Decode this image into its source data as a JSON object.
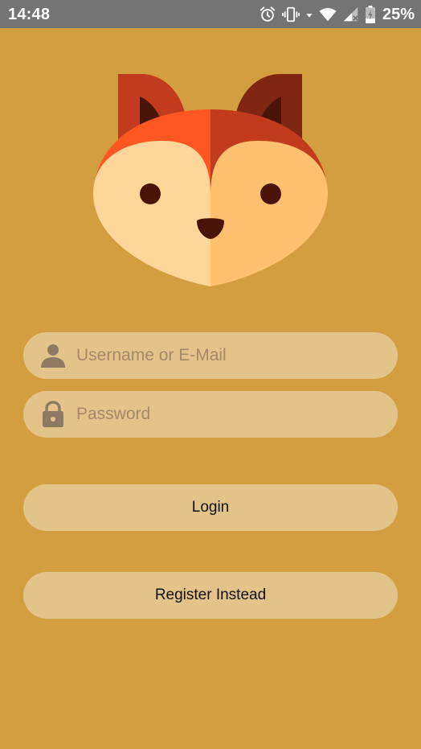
{
  "status_bar": {
    "time": "14:48",
    "battery": "25%",
    "icons": [
      "alarm-icon",
      "vibrate-icon",
      "data-arrow-icon",
      "wifi-icon",
      "cell-signal-icon",
      "battery-icon"
    ]
  },
  "logo": {
    "icon": "fox-logo",
    "colors": {
      "ear_outer": "#C13B1C",
      "ear_inner": "#4A1508",
      "head_left": "#FF5722",
      "head_right": "#C13B1C",
      "cheek_left": "#FFD699",
      "cheek_right": "#FFC16F",
      "eye": "#4A1508",
      "nose": "#4A1508"
    }
  },
  "form": {
    "username": {
      "placeholder": "Username or E-Mail",
      "value": "",
      "icon": "person-icon"
    },
    "password": {
      "placeholder": "Password",
      "value": "",
      "icon": "lock-icon"
    }
  },
  "buttons": {
    "login_label": "Login",
    "register_label": "Register Instead"
  },
  "colors": {
    "background": "#D39E40",
    "field_bg": "#E4C38B",
    "status_bar": "#747474",
    "placeholder": "#A4896A"
  }
}
